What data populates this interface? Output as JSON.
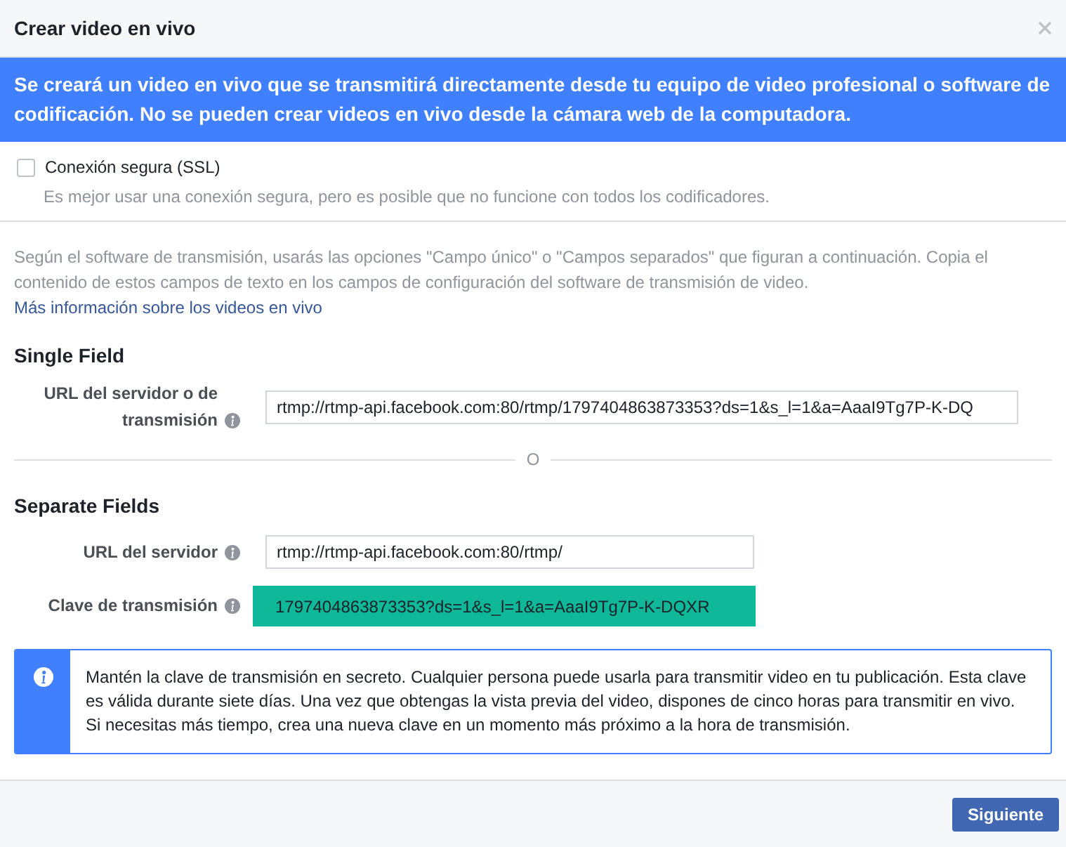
{
  "dialog": {
    "title": "Crear video en vivo"
  },
  "banner": {
    "text": "Se creará un video en vivo que se transmitirá directamente desde tu equipo de video profesional o software de codificación. No se pueden crear videos en vivo desde la cámara web de la computadora."
  },
  "ssl_option": {
    "label": "Conexión segura (SSL)",
    "checked": false,
    "hint": "Es mejor usar una conexión segura, pero es posible que no funcione con todos los codificadores."
  },
  "instructions": {
    "text": "Según el software de transmisión, usarás las opciones \"Campo único\" o \"Campos separados\" que figuran a continuación. Copia el contenido de estos campos de texto en los campos de configuración del software de transmisión de video.",
    "link": "Más información sobre los videos en vivo"
  },
  "single_field": {
    "heading": "Single Field",
    "fields": [
      {
        "label": "URL del servidor o de transmisión",
        "value": "rtmp://rtmp-api.facebook.com:80/rtmp/1797404863873353?ds=1&s_l=1&a=AaaI9Tg7P-K-DQ",
        "highlighted": false
      }
    ]
  },
  "separator": {
    "text": "O"
  },
  "separate_fields": {
    "heading": "Separate Fields",
    "fields": [
      {
        "label": "URL del servidor",
        "value": "rtmp://rtmp-api.facebook.com:80/rtmp/",
        "highlighted": false
      },
      {
        "label": "Clave de transmisión",
        "value": "1797404863873353?ds=1&s_l=1&a=AaaI9Tg7P-K-DQXR",
        "highlighted": true
      }
    ]
  },
  "notice": {
    "text": "Mantén la clave de transmisión en secreto. Cualquier persona puede usarla para transmitir video en tu publicación. Esta clave es válida durante siete días. Una vez que obtengas la vista previa del video, dispones de cinco horas para transmitir en vivo. Si necesitas más tiempo, crea una nueva clave en un momento más próximo a la hora de transmisión."
  },
  "footer": {
    "buttons": [
      {
        "label": "Siguiente",
        "primary": true
      }
    ]
  }
}
